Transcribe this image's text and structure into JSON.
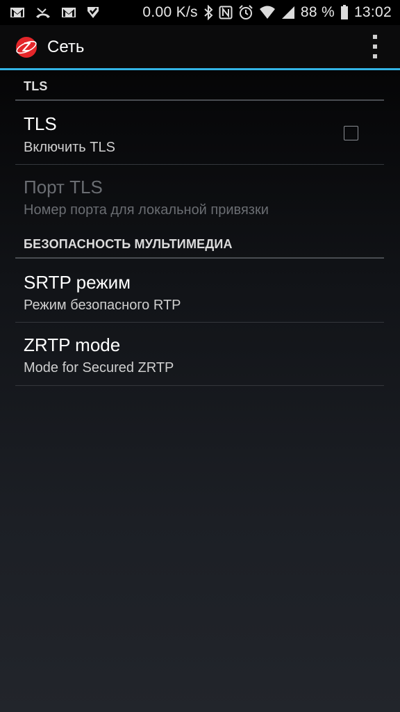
{
  "status_bar": {
    "net_speed": "0.00 K/s",
    "battery": "88 %",
    "time": "13:02",
    "left_icons": [
      "gmail-icon",
      "missed-call-icon",
      "gmail-icon",
      "notification-icon"
    ],
    "right_icons": [
      "bluetooth-icon",
      "nfc-icon",
      "alarm-icon",
      "wifi-icon",
      "signal-icon",
      "battery-icon"
    ]
  },
  "action_bar": {
    "title": "Сеть",
    "logo_letter": "Z",
    "accent_color": "#33b5e5",
    "logo_color": "#e3262a"
  },
  "sections": [
    {
      "header": "TLS",
      "items": [
        {
          "title": "TLS",
          "summary": "Включить TLS",
          "checkbox": false,
          "enabled": true
        },
        {
          "title": "Порт TLS",
          "summary": "Номер порта для локальной привязки",
          "enabled": false
        }
      ]
    },
    {
      "header": "БЕЗОПАСНОСТЬ МУЛЬТИМЕДИА",
      "items": [
        {
          "title": "SRTP режим",
          "summary": "Режим безопасного RTP",
          "enabled": true
        },
        {
          "title": "ZRTP mode",
          "summary": "Mode for Secured ZRTP",
          "enabled": true
        }
      ]
    }
  ]
}
